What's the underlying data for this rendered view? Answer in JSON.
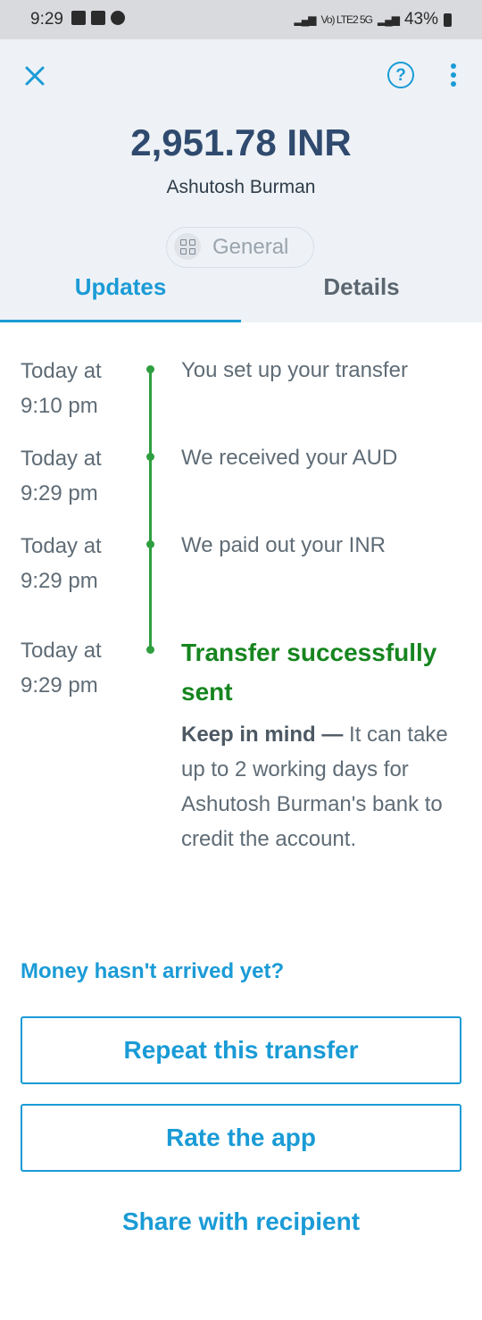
{
  "status_bar": {
    "time": "9:29",
    "network": "Vo) LTE2 5G",
    "battery": "43%"
  },
  "header": {
    "amount": "2,951.78 INR",
    "recipient": "Ashutosh Burman",
    "category": "General"
  },
  "tabs": [
    {
      "label": "Updates",
      "active": true
    },
    {
      "label": "Details",
      "active": false
    }
  ],
  "timeline": [
    {
      "time_line1": "Today at",
      "time_line2": "9:10 pm",
      "text": "You set up your transfer"
    },
    {
      "time_line1": "Today at",
      "time_line2": "9:29 pm",
      "text": "We received your AUD"
    },
    {
      "time_line1": "Today at",
      "time_line2": "9:29 pm",
      "text": "We paid out your INR"
    },
    {
      "time_line1": "Today at",
      "time_line2": "9:29 pm",
      "title": "Transfer successfully sent",
      "note_bold": "Keep in mind —",
      "note_text": " It can take up to 2 working days for Ashutosh Burman's bank to credit the account."
    }
  ],
  "actions": {
    "money_link": "Money hasn't arrived yet?",
    "repeat": "Repeat this transfer",
    "rate": "Rate the app",
    "share": "Share with recipient"
  },
  "colors": {
    "accent": "#1a9bd6",
    "success": "#2e9e3e",
    "heading": "#2f4a6e"
  }
}
